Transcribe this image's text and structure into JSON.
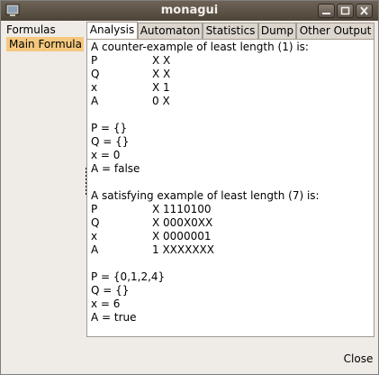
{
  "window": {
    "title": "monagui"
  },
  "left_panel": {
    "header": "Formulas",
    "items": [
      {
        "label": "Main Formula",
        "selected": true
      }
    ]
  },
  "tabs": [
    {
      "label": "Analysis",
      "active": true
    },
    {
      "label": "Automaton",
      "active": false
    },
    {
      "label": "Statistics",
      "active": false
    },
    {
      "label": "Dump",
      "active": false
    },
    {
      "label": "Other Output",
      "active": false
    }
  ],
  "content": {
    "counter_title": "A counter-example of least length (1) is:",
    "counter_rows": [
      {
        "name": "P",
        "value": "X X"
      },
      {
        "name": "Q",
        "value": "X X"
      },
      {
        "name": "x",
        "value": "X 1"
      },
      {
        "name": "A",
        "value": "0 X"
      }
    ],
    "counter_assign": [
      "P = {}",
      "Q = {}",
      "x = 0",
      "A = false"
    ],
    "sat_title": "A satisfying example of least length (7) is:",
    "sat_rows": [
      {
        "name": "P",
        "value": "X 1110100"
      },
      {
        "name": "Q",
        "value": "X 000X0XX"
      },
      {
        "name": "x",
        "value": "X 0000001"
      },
      {
        "name": "A",
        "value": "1 XXXXXXX"
      }
    ],
    "sat_assign": [
      "P = {0,1,2,4}",
      "Q = {}",
      "x = 6",
      "A = true"
    ]
  },
  "buttons": {
    "close": "Close"
  },
  "colors": {
    "title_bar": "#4d4438",
    "selected_item": "#f5c87e",
    "window_bg": "#efebe7"
  }
}
